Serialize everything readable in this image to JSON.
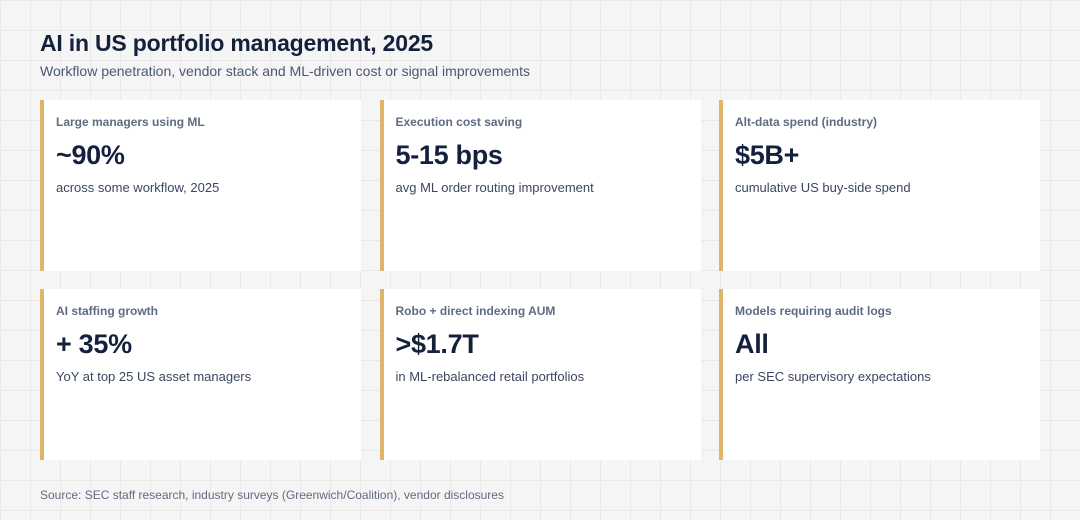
{
  "header": {
    "title": "AI in US portfolio management, 2025",
    "subtitle": "Workflow penetration, vendor stack and ML-driven cost or signal improvements"
  },
  "accent_color": "#ddb56b",
  "cards": [
    {
      "label": "Large managers using ML",
      "value": "~90%",
      "description": "across some workflow, 2025"
    },
    {
      "label": "Execution cost saving",
      "value": "5-15 bps",
      "description": "avg ML order routing improvement"
    },
    {
      "label": "Alt-data spend (industry)",
      "value": "$5B+",
      "description": "cumulative US buy-side spend"
    },
    {
      "label": "AI staffing growth",
      "value": "+ 35%",
      "description": "YoY at top 25 US asset managers"
    },
    {
      "label": "Robo + direct indexing AUM",
      "value": ">$1.7T",
      "description": "in ML-rebalanced retail portfolios"
    },
    {
      "label": "Models requiring audit logs",
      "value": "All",
      "description": "per SEC supervisory expectations"
    }
  ],
  "footer": {
    "source": "Source: SEC staff research, industry surveys (Greenwich/Coalition), vendor disclosures"
  }
}
